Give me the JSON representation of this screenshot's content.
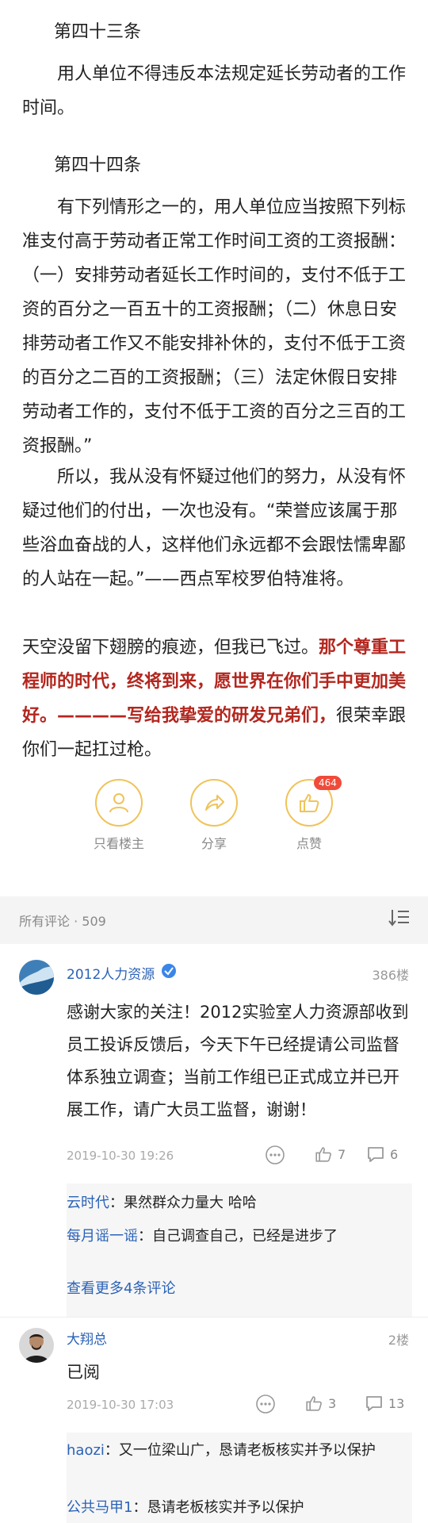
{
  "article": {
    "h43": "第四十三条",
    "p43": "用人单位不得违反本法规定延长劳动者的工作时间。",
    "h44": "第四十四条",
    "p44": "有下列情形之一的，用人单位应当按照下列标准支付高于劳动者正常工作时间工资的工资报酬：（一）安排劳动者延长工作时间的，支付不低于工资的百分之一百五十的工资报酬；（二）休息日安排劳动者工作又不能安排补休的，支付不低于工资的百分之二百的工资报酬；（三）法定休假日安排劳动者工作的，支付不低于工资的百分之三百的工资报酬。”",
    "p_so": "所以，我从没有怀疑过他们的努力，从没有怀疑过他们的付出，一次也没有。“荣誉应该属于那些浴血奋战的人，这样他们永远都不会跟怯懦卑鄙的人站在一起。”——西点军校罗伯特准将。",
    "p_sky_a": "天空没留下翅膀的痕迹，但我已飞过。",
    "p_sky_red": "那个尊重工程师的时代，终将到来，愿世界在你们手中更加美好。————写给我挚爱的研发兄弟们，",
    "p_sky_b": "很荣幸跟你们一起扛过枪。"
  },
  "actions": {
    "only_author": "只看楼主",
    "share": "分享",
    "like": "点赞",
    "like_count": "464"
  },
  "comments_header": "所有评论 · 509",
  "comments": [
    {
      "user": "2012人力资源",
      "floor": "386楼",
      "text": "感谢大家的关注！2012实验室人力资源部收到员工投诉反馈后，今天下午已经提请公司监督体系独立调查；当前工作组已正式成立并已开展工作，请广大员工监督，谢谢！",
      "time": "2019-10-30 19:26",
      "likes": "7",
      "replies_count": "6",
      "replies": [
        {
          "who": "云时代",
          "text": "：果然群众力量大 哈哈"
        },
        {
          "who": "每月谣一谣",
          "text": "：自己调查自己，已经是进步了"
        }
      ],
      "more": "查看更多4条评论"
    },
    {
      "user": "大翔总",
      "floor": "2楼",
      "text": "已阅",
      "time": "2019-10-30 17:03",
      "likes": "3",
      "replies_count": "13",
      "replies": [
        {
          "who": "haozi",
          "text": "：又一位梁山广，恳请老板核实并予以保护"
        },
        {
          "who": "公共马甲1",
          "text": "：恳请老板核实并予以保护"
        }
      ]
    }
  ],
  "colors": {
    "link": "#2b62b6",
    "red_text": "#b3261e",
    "ring": "#f0c35a",
    "badge": "#f04a3a"
  },
  "icons": [
    "user-icon",
    "share-icon",
    "thumbs-up-icon",
    "sort-icon",
    "more-icon",
    "comment-icon"
  ]
}
